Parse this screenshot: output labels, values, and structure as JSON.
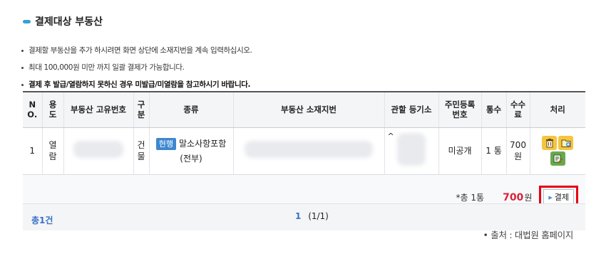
{
  "section": {
    "title": "결제대상 부동산"
  },
  "notes": [
    "결제할 부동산을 추가 하시려면 화면 상단에 소재지번을 계속 입력하십시오.",
    "최대 100,000원 미만 까지 일괄 결제가 가능합니다.",
    "결제 후 발급/열람하지 못하신 경우 미발급/미열람을 참고하시기 바랍니다."
  ],
  "table": {
    "headers": {
      "no": "N O.",
      "use": "용 도",
      "uid": "부동산 고유번호",
      "div": "구 분",
      "kind": "종류",
      "addr": "부동산 소재지번",
      "office": "관할 등기소",
      "rrn": "주민등록 번호",
      "copies": "통수",
      "fee": "수수 료",
      "action": "처리"
    },
    "row": {
      "no": "1",
      "use": "열 람",
      "div": "건 물",
      "badge": "현행",
      "kind": "말소사항포함",
      "kind_sub": "(전부)",
      "office_mark": "^",
      "rrn": "미공개",
      "copies": "1 통",
      "fee": "700 원"
    },
    "summary": {
      "count": "*총 1통",
      "amount": "700",
      "unit": "원",
      "pay_label": "결제"
    }
  },
  "footer": {
    "total": "총1건",
    "page_current": "1",
    "page_info": "(1/1)"
  },
  "source": "• 출처 : 대법원 홈페이지",
  "colors": {
    "accent": "#3a9fd8",
    "badge": "#3d87d0",
    "amount": "#d8233a",
    "highlight": "#e60012"
  }
}
